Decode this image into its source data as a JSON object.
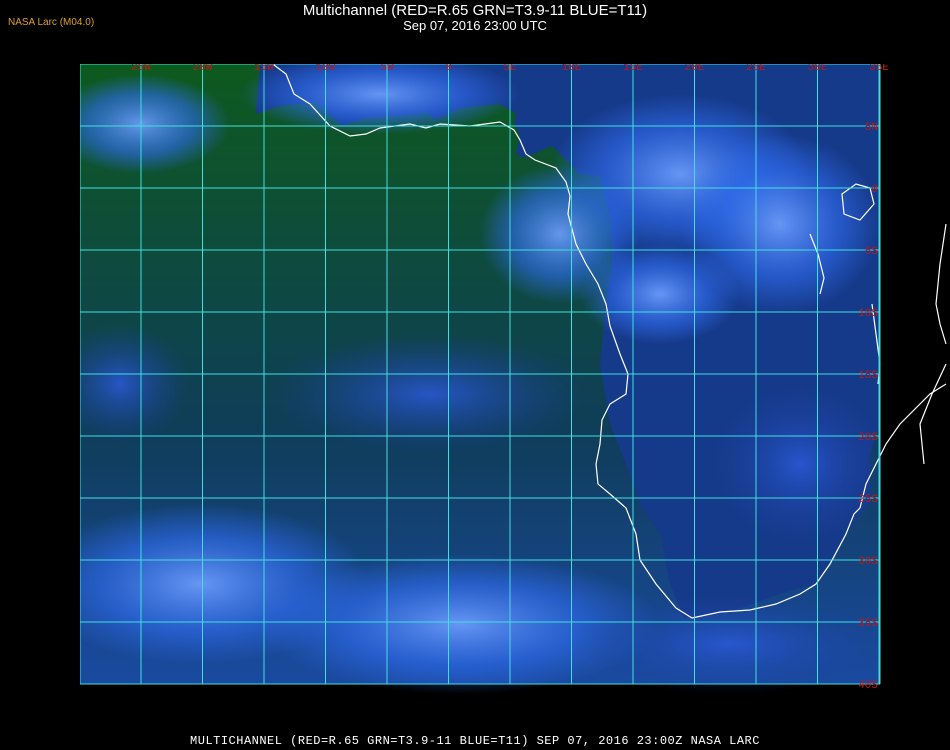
{
  "header": {
    "title": "Multichannel (RED=R.65 GRN=T3.9-11 BLUE=T11)",
    "subtitle": "Sep 07, 2016 23:00 UTC",
    "credit": "NASA Larc (M04.0)"
  },
  "footer": {
    "text": "MULTICHANNEL (RED=R.65 GRN=T3.9-11 BLUE=T11) SEP 07, 2016 23:00Z   NASA LARC"
  },
  "map": {
    "lon_labels": [
      "25W",
      "20W",
      "15W",
      "10W",
      "5W",
      "0",
      "5E",
      "10E",
      "15E",
      "20E",
      "25E",
      "30E",
      "35E"
    ],
    "lat_labels": [
      "5N",
      "0",
      "5S",
      "10S",
      "15S",
      "20S",
      "25S",
      "30S",
      "35S",
      "40S"
    ],
    "colors": {
      "grid": "#40e0e0",
      "label": "#c01818",
      "coast": "#ffffff",
      "ocean": "#0c4a1c",
      "cloud": "#2f6cf0"
    }
  }
}
